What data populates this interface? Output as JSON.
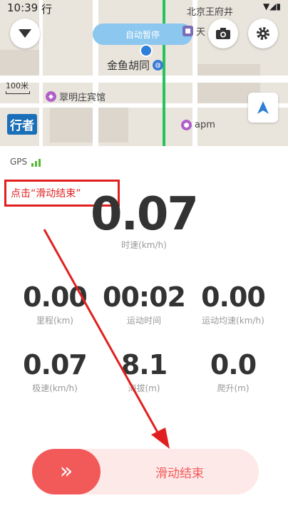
{
  "status_bar": {
    "time": "10:39",
    "extra": "行"
  },
  "map": {
    "auto_pause_label": "自动暂停",
    "scale_label": "100米",
    "pois": {
      "hutong": "金鱼胡同",
      "hotel": "翠明庄宾馆",
      "apm": "apm",
      "north_top": "北京王府井",
      "north_bottom": "天",
      "brand": "行者"
    }
  },
  "gps": {
    "label": "GPS"
  },
  "annotation": {
    "text": "点击“滑动结束”"
  },
  "speed": {
    "value": "0.07",
    "label": "时速(km/h)"
  },
  "stats": [
    {
      "value": "0.00",
      "label": "里程(km)"
    },
    {
      "value": "00:02",
      "label": "运动时间"
    },
    {
      "value": "0.00",
      "label": "运动均速(km/h)"
    },
    {
      "value": "0.07",
      "label": "极速(km/h)"
    },
    {
      "value": "8.1",
      "label": "海拔(m)"
    },
    {
      "value": "0.0",
      "label": "爬升(m)"
    }
  ],
  "slider": {
    "handle_symbol": "»",
    "label": "滑动结束"
  },
  "colors": {
    "accent": "#f25a5a",
    "annotation": "#e02020",
    "gps_signal": "#55b832",
    "pill": "#8bc7ee"
  }
}
